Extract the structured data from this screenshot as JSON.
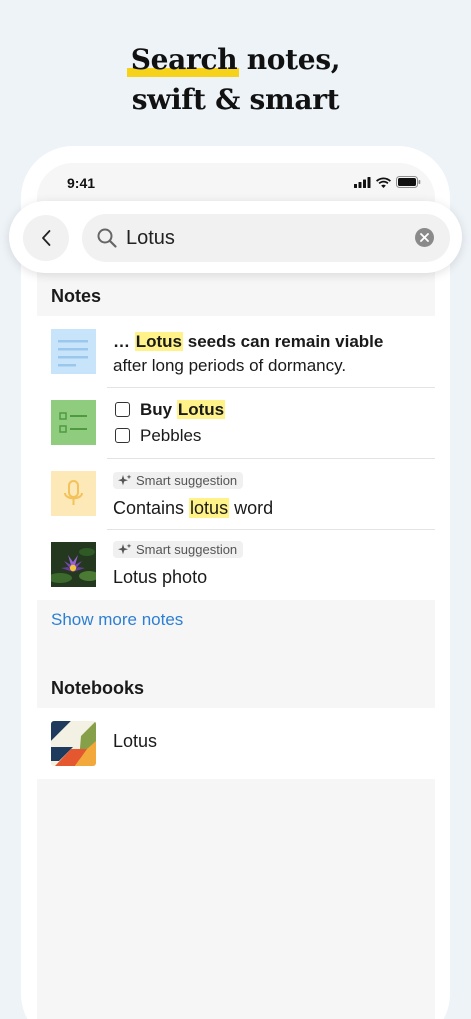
{
  "headline": {
    "line1_highlight": "Search",
    "line1_rest": " notes,",
    "line2": "swift & smart"
  },
  "status_bar": {
    "time": "9:41"
  },
  "search": {
    "value": "Lotus"
  },
  "notes_section": {
    "title": "Notes",
    "items": [
      {
        "pre": "… ",
        "match": "Lotus",
        "post": " seeds can remain viable",
        "line2": "after long periods of dormancy."
      },
      {
        "check1_pre": "Buy ",
        "check1_match": "Lotus",
        "check2": "Pebbles"
      },
      {
        "chip": "Smart suggestion",
        "pre": "Contains ",
        "match": "lotus",
        "post": " word"
      },
      {
        "chip": "Smart suggestion",
        "text": "Lotus photo"
      }
    ],
    "show_more": "Show more notes"
  },
  "notebooks_section": {
    "title": "Notebooks",
    "items": [
      {
        "name": "Lotus"
      }
    ]
  },
  "colors": {
    "highlight": "#fef288",
    "headline_accent": "#f6d21a",
    "link": "#2d7fd3"
  },
  "icons": [
    "back-chevron-icon",
    "search-icon",
    "clear-icon",
    "sparkle-icon",
    "microphone-icon",
    "checklist-icon",
    "document-lines-icon",
    "signal-icon",
    "wifi-icon",
    "battery-icon"
  ]
}
